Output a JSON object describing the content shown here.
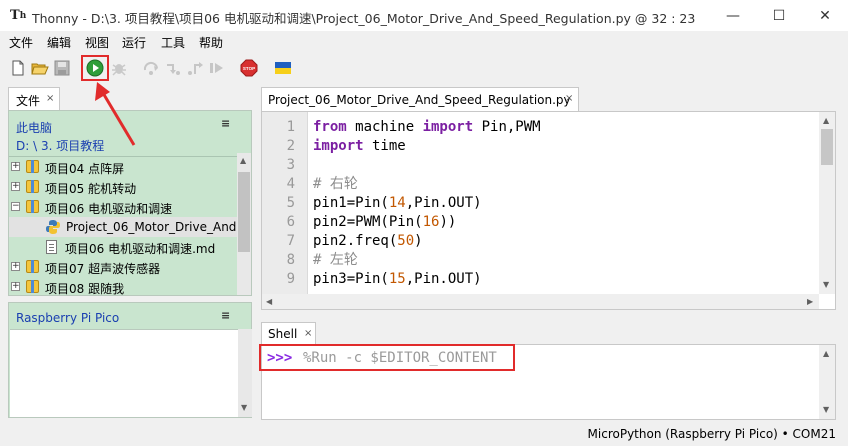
{
  "window": {
    "app_name": "Thonny",
    "title": "Thonny  -  D:\\3. 项目教程\\项目06 电机驱动和调速\\Project_06_Motor_Drive_And_Speed_Regulation.py  @  32 : 23",
    "controls": {
      "minimize": "—",
      "maximize": "☐",
      "close": "✕"
    }
  },
  "menubar": {
    "items": [
      "文件",
      "编辑",
      "视图",
      "运行",
      "工具",
      "帮助"
    ]
  },
  "toolbar": {
    "icons": [
      "new-file",
      "open-file",
      "save-file",
      "run-current-script",
      "debug",
      "step-over",
      "step-into",
      "step-out",
      "resume",
      "stop",
      "ukraine-flag"
    ],
    "stop_label": "STOP"
  },
  "files_panel": {
    "tab_label": "文件",
    "tab_close": "×",
    "location_title": "此电脑",
    "location_path": "D: \\ 3. 项目教程",
    "menu_glyph": "≡",
    "tree": [
      {
        "label": "项目04 点阵屏",
        "type": "folder",
        "expander": "+"
      },
      {
        "label": "项目05 舵机转动",
        "type": "folder",
        "expander": "+"
      },
      {
        "label": "项目06 电机驱动和调速",
        "type": "folder",
        "expander": "−"
      },
      {
        "label": "Project_06_Motor_Drive_And_",
        "type": "python-file",
        "selected": true
      },
      {
        "label": "项目06 电机驱动和调速.md",
        "type": "md-file"
      },
      {
        "label": "项目07 超声波传感器",
        "type": "folder",
        "expander": "+"
      },
      {
        "label": "项目08 跟随我",
        "type": "folder",
        "expander": "+"
      }
    ]
  },
  "pico_panel": {
    "title": "Raspberry Pi Pico",
    "menu_glyph": "≡"
  },
  "editor": {
    "tab_label": "Project_06_Motor_Drive_And_Speed_Regulation.py",
    "tab_close": "×",
    "line_numbers": [
      "1",
      "2",
      "3",
      "4",
      "5",
      "6",
      "7",
      "8",
      "9"
    ],
    "lines": [
      "from machine import Pin,PWM",
      "import time",
      "",
      "# 右轮",
      "pin1=Pin(14,Pin.OUT)",
      "pin2=PWM(Pin(16))",
      "pin2.freq(50)",
      "# 左轮",
      "pin3=Pin(15,Pin.OUT)"
    ]
  },
  "shell": {
    "tab_label": "Shell",
    "tab_close": "×",
    "prompt": ">>>",
    "command": "%Run -c $EDITOR_CONTENT"
  },
  "statusbar": {
    "text": "MicroPython (Raspberry Pi Pico)  •  COM21"
  },
  "colors": {
    "highlight": "#e12b2b",
    "panel_green": "#c9e5cf",
    "link_blue": "#1a3fb0",
    "keyword": "#7b1fa2",
    "number": "#c25700",
    "comment": "#8d8d8d",
    "prompt": "#8a2be2"
  }
}
